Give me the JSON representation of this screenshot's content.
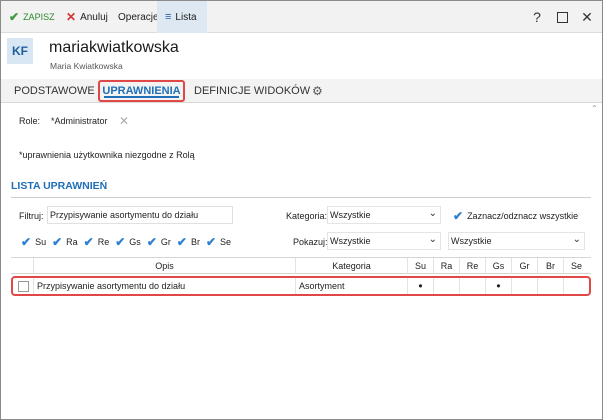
{
  "toolbar": {
    "save_label": "ZAPISZ",
    "cancel_label": "Anuluj",
    "operations_label": "Operacje",
    "list_label": "Lista",
    "help": "?"
  },
  "header": {
    "avatar_initials": "KF",
    "title": "mariakwiatkowska",
    "subtitle": "Maria Kwiatkowska"
  },
  "tabs": [
    {
      "label": "PODSTAWOWE"
    },
    {
      "label": "UPRAWNIENIA"
    },
    {
      "label": "DEFINICJE WIDOKÓW"
    }
  ],
  "role": {
    "label": "Role:",
    "value": "*Administrator"
  },
  "note": "*uprawnienia użytkownika niezgodne z Rolą",
  "section_title": "LISTA UPRAWNIEŃ",
  "filter": {
    "label": "Filtruj:",
    "value": "Przypisywanie asortymentu do działu"
  },
  "category_filter": {
    "label": "Kategoria:",
    "value": "Wszystkie"
  },
  "select_all_label": "Zaznacz/odznacz wszystkie",
  "show": {
    "label": "Pokazuj:",
    "value1": "Wszystkie",
    "value2": "Wszystkie"
  },
  "flags": [
    "Su",
    "Ra",
    "Re",
    "Gs",
    "Gr",
    "Br",
    "Se"
  ],
  "table": {
    "headers": [
      "Opis",
      "Kategoria",
      "Su",
      "Ra",
      "Re",
      "Gs",
      "Gr",
      "Br",
      "Se"
    ],
    "rows": [
      {
        "opis": "Przypisywanie asortymentu do działu",
        "kategoria": "Asortyment",
        "su": "•",
        "ra": "",
        "re": "",
        "gs": "•",
        "gr": "",
        "br": "",
        "se": ""
      }
    ]
  },
  "colors": {
    "accent": "#1f6fb8",
    "highlight_border": "#e04848",
    "save_green": "#2b8a2b",
    "cancel_red": "#d23434"
  }
}
